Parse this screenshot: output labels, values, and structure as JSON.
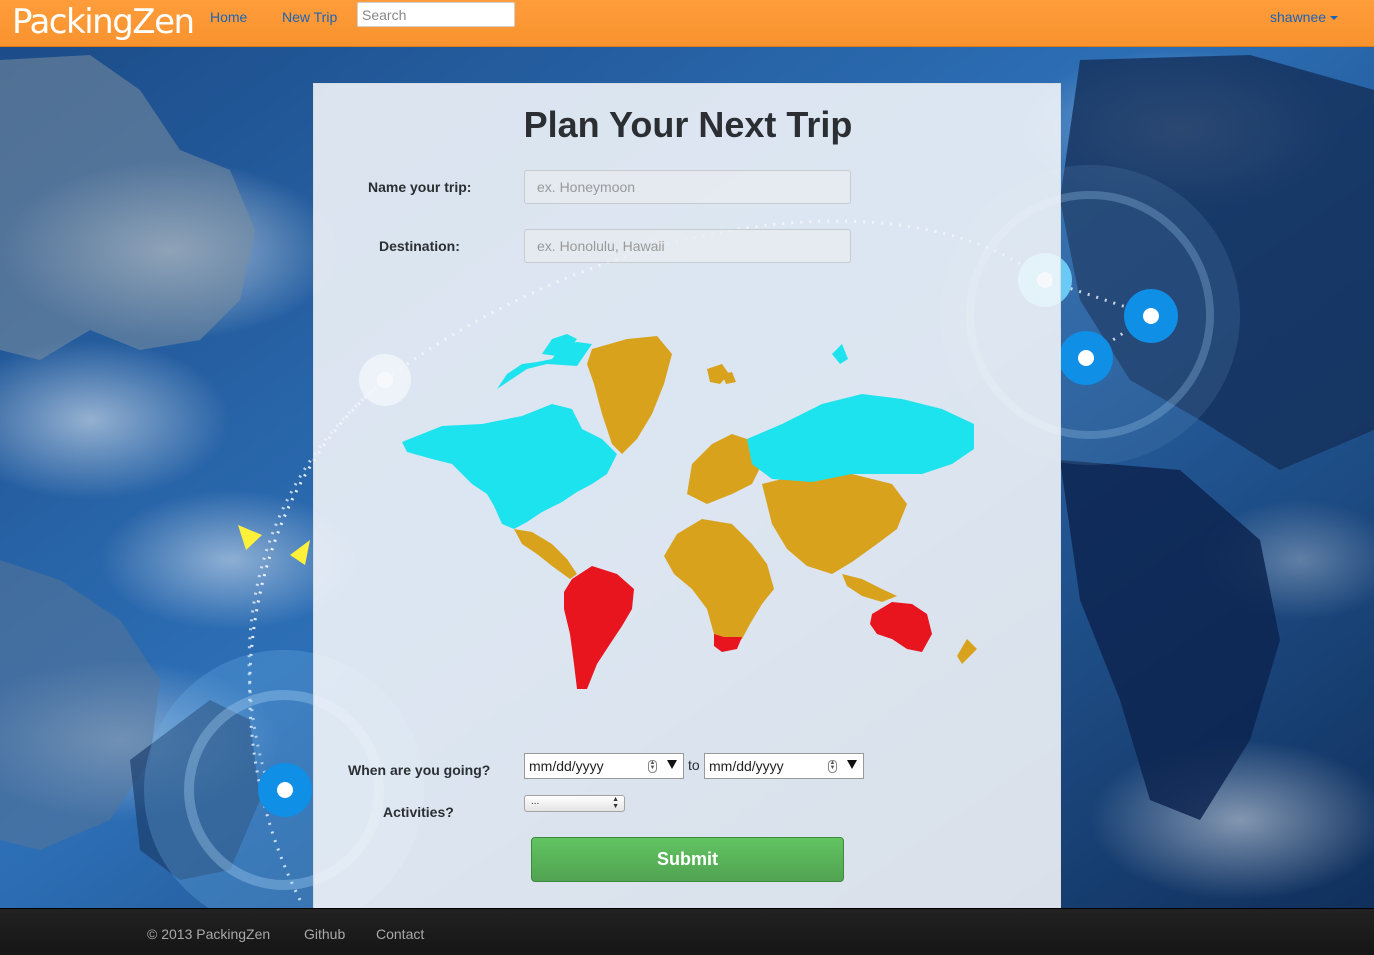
{
  "navbar": {
    "brand": "PackingZen",
    "links": [
      "Home",
      "New Trip"
    ],
    "search_placeholder": "Search",
    "user": "shawnee",
    "accent_color": "#f8932e"
  },
  "form": {
    "title": "Plan Your Next Trip",
    "name_label": "Name your trip:",
    "name_placeholder": "ex. Honeymoon",
    "destination_label": "Destination:",
    "destination_placeholder": "ex. Honolulu, Hawaii",
    "dates_label": "When are you going?",
    "start_date_placeholder": "mm/dd/yyyy",
    "to_label": "to",
    "end_date_placeholder": "mm/dd/yyyy",
    "activities_label": "Activities?",
    "activities_selected": "...",
    "submit_label": "Submit"
  },
  "map_colors": {
    "north_america_russia": "#1de3ee",
    "europe_africa_asia": "#d9a21d",
    "south_america_australia": "#e8141e"
  },
  "footer": {
    "copyright": "© 2013 PackingZen",
    "links": [
      "Github",
      "Contact"
    ]
  }
}
